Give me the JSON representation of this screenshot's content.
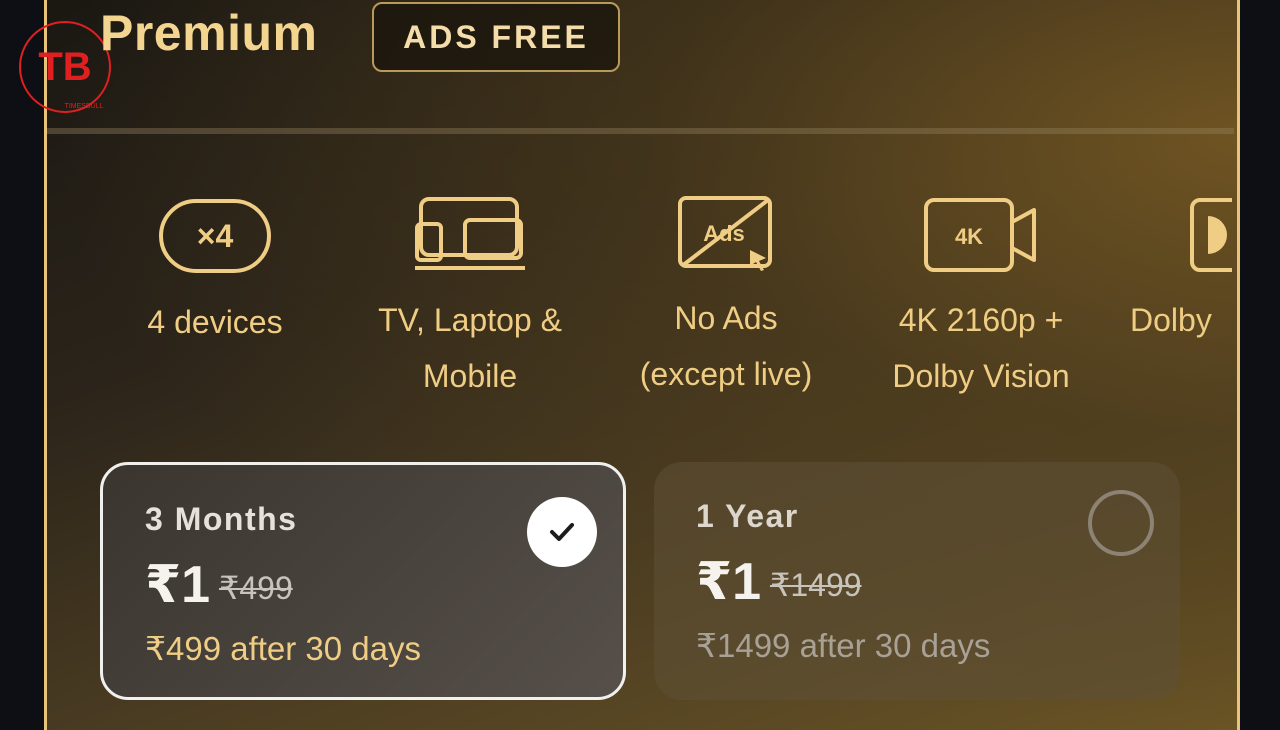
{
  "brand": {
    "logo_text": "TB",
    "logo_subtext": "TIMESBULL"
  },
  "header": {
    "title": "Premium",
    "badge": "ADS FREE"
  },
  "features": [
    {
      "icon": "x4-devices-icon",
      "icon_text": "×4",
      "label_line1": "4 devices",
      "label_line2": ""
    },
    {
      "icon": "tv-laptop-mobile-icon",
      "label_line1": "TV, Laptop &",
      "label_line2": "Mobile"
    },
    {
      "icon": "no-ads-icon",
      "icon_text": "Ads",
      "label_line1": "No Ads",
      "label_line2": "(except live)"
    },
    {
      "icon": "4k-camera-icon",
      "icon_text": "4K",
      "label_line1": "4K 2160p +",
      "label_line2": "Dolby Vision"
    },
    {
      "icon": "dolby-icon",
      "label_line1": "Dolby",
      "label_line2": ""
    }
  ],
  "plans": [
    {
      "name": "3 Months",
      "price": "₹1",
      "original_price": "₹499",
      "after_text": "₹499 after 30 days",
      "selected": true
    },
    {
      "name": "1 Year",
      "price": "₹1",
      "original_price": "₹1499",
      "after_text": "₹1499 after 30 days",
      "selected": false
    }
  ],
  "colors": {
    "accent_gold": "#f0cd84",
    "border_gold": "#e8c47a",
    "logo_red": "#e02020"
  }
}
